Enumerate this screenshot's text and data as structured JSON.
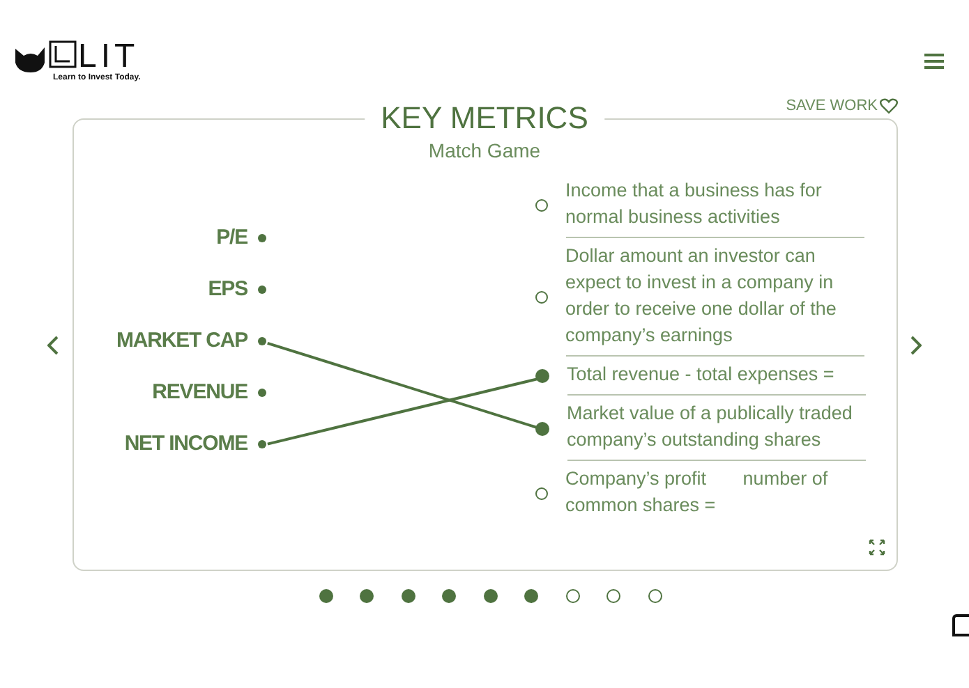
{
  "logo": {
    "name": "LIT",
    "tagline": "Learn to Invest Today."
  },
  "save_label": "SAVE WORK",
  "card": {
    "title": "KEY METRICS",
    "subtitle": "Match Game",
    "terms": [
      {
        "label": "P/E",
        "links": [
          false,
          false,
          false,
          false,
          false
        ]
      },
      {
        "label": "EPS",
        "links": [
          false,
          false,
          false,
          false,
          false
        ]
      },
      {
        "label": "MARKET CAP",
        "links": [
          false,
          false,
          false,
          true,
          false
        ]
      },
      {
        "label": "REVENUE",
        "links": [
          false,
          false,
          false,
          false,
          false
        ]
      },
      {
        "label": "NET INCOME",
        "links": [
          false,
          false,
          true,
          false,
          false
        ]
      }
    ],
    "definitions": [
      {
        "text": "Income that a business has for normal business activities",
        "selected": false
      },
      {
        "text": "Dollar amount an investor can expect to invest in a company in order to receive one dollar of the company’s earnings",
        "selected": false
      },
      {
        "text": "Total revenue - total expenses =",
        "selected": true
      },
      {
        "text": "Market value of a publically traded company’s outstanding shares",
        "selected": true
      },
      {
        "text": "Company’s profit       number of common shares =",
        "selected": false
      }
    ]
  },
  "pages": [
    {
      "done": true
    },
    {
      "done": true
    },
    {
      "done": true
    },
    {
      "done": true
    },
    {
      "done": true
    },
    {
      "done": true
    },
    {
      "done": false
    },
    {
      "done": false
    },
    {
      "done": false
    }
  ]
}
